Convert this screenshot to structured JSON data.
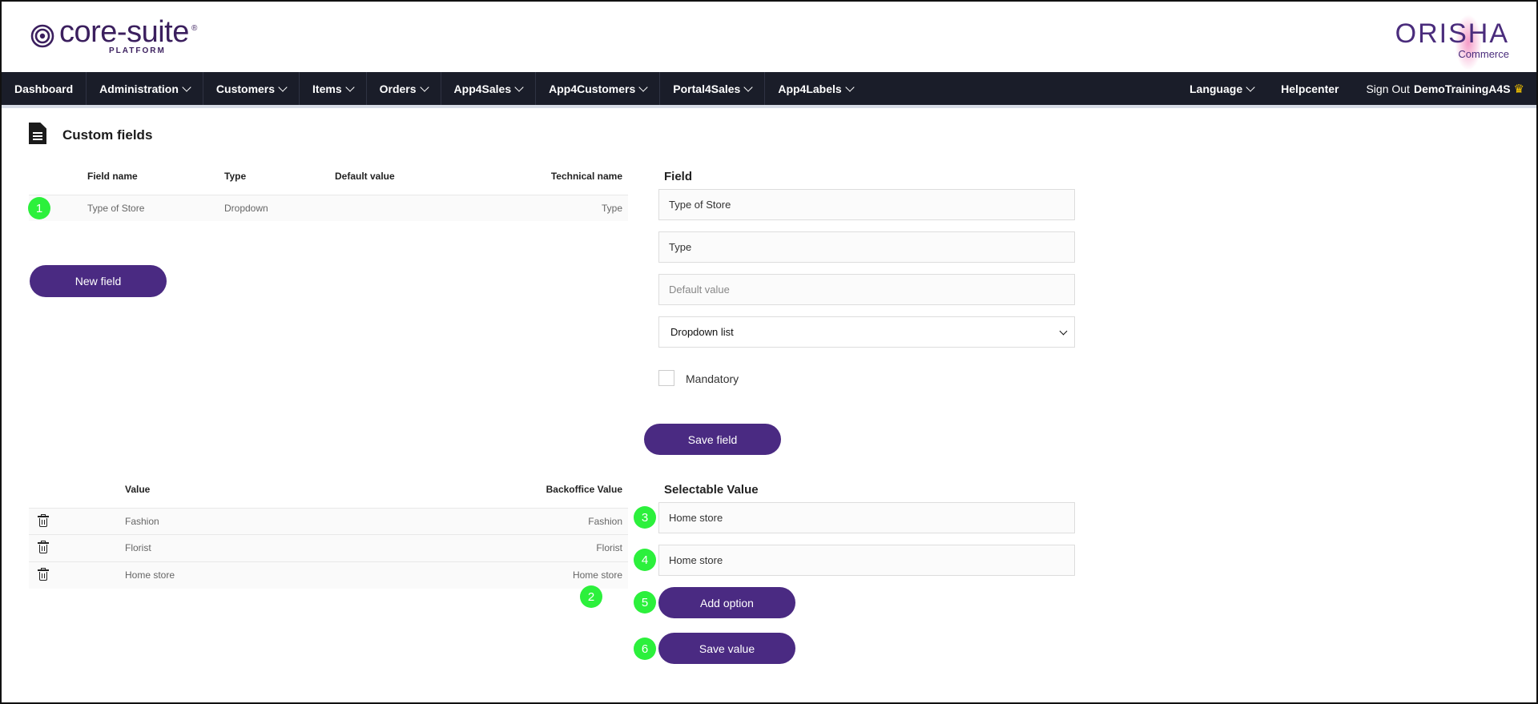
{
  "header": {
    "logo_text": "core-suite",
    "logo_reg": "®",
    "logo_sub": "PLATFORM",
    "brand_name": "ORISHA",
    "brand_sub": "Commerce"
  },
  "nav": {
    "items": [
      {
        "label": "Dashboard",
        "dropdown": false
      },
      {
        "label": "Administration",
        "dropdown": true
      },
      {
        "label": "Customers",
        "dropdown": true
      },
      {
        "label": "Items",
        "dropdown": true
      },
      {
        "label": "Orders",
        "dropdown": true
      },
      {
        "label": "App4Sales",
        "dropdown": true
      },
      {
        "label": "App4Customers",
        "dropdown": true
      },
      {
        "label": "Portal4Sales",
        "dropdown": true
      },
      {
        "label": "App4Labels",
        "dropdown": true
      }
    ],
    "language": "Language",
    "helpcenter": "Helpcenter",
    "signout": "Sign Out",
    "username": "DemoTrainingA4S",
    "crown": "♛"
  },
  "page": {
    "title": "Custom fields"
  },
  "fields_table": {
    "headers": [
      "Field name",
      "Type",
      "Default value",
      "Technical name"
    ],
    "rows": [
      {
        "field_name": "Type of Store",
        "type": "Dropdown",
        "default_value": "",
        "technical_name": "Type"
      }
    ],
    "new_field_button": "New field"
  },
  "field_form": {
    "title": "Field",
    "name_value": "Type of Store",
    "technical_value": "Type",
    "default_placeholder": "Default value",
    "type_select": "Dropdown list",
    "mandatory_label": "Mandatory",
    "mandatory_checked": false,
    "save_button": "Save field"
  },
  "values_table": {
    "headers": [
      "Value",
      "Backoffice Value"
    ],
    "rows": [
      {
        "value": "Fashion",
        "backoffice": "Fashion"
      },
      {
        "value": "Florist",
        "backoffice": "Florist"
      },
      {
        "value": "Home store",
        "backoffice": "Home store"
      }
    ]
  },
  "value_form": {
    "title": "Selectable Value",
    "value_input": "Home store",
    "backoffice_input": "Home store",
    "add_button": "Add option",
    "save_button": "Save value"
  },
  "markers": [
    "1",
    "2",
    "3",
    "4",
    "5",
    "6"
  ],
  "colors": {
    "brand_purple": "#4a2a82",
    "nav_background": "#1a1d29",
    "marker_green": "#2cf03c",
    "crown_gold": "#f5c400"
  }
}
